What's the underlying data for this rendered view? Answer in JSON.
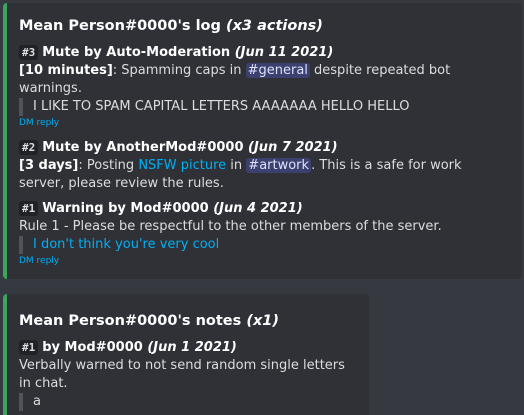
{
  "log": {
    "title": "Mean Person#0000's log",
    "count": "(x3 actions)",
    "entries": [
      {
        "num": "#3",
        "action": "Mute by Auto-Moderation",
        "date": "(Jun 11 2021)",
        "duration": "[10 minutes]",
        "text_before": ": Spamming caps in ",
        "mention": "#general",
        "text_after": " despite repeated bot warnings.",
        "quote": "I LIKE TO SPAM CAPITAL LETTERS AAAAAAA HELLO HELLO",
        "dm_reply": "DM reply"
      },
      {
        "num": "#2",
        "action": "Mute by AnotherMod#0000",
        "date": "(Jun 7 2021)",
        "duration": "[3 days]",
        "text_before": ": Posting ",
        "link": "NSFW picture",
        "text_mid": " in ",
        "mention": "#artwork",
        "text_after": ". This is a safe for work server, please review the rules."
      },
      {
        "num": "#1",
        "action": "Warning by Mod#0000",
        "date": "(Jun 4 2021)",
        "text": "Rule 1 - Please be respectful to the other members of the server.",
        "quote": "I don't think you're very cool",
        "dm_reply": "DM reply"
      }
    ]
  },
  "notes": {
    "title": "Mean Person#0000's notes",
    "count": "(x1)",
    "entries": [
      {
        "num": "#1",
        "action": "by Mod#0000",
        "date": "(Jun 1 2021)",
        "text": "Verbally warned to not send random single letters in chat.",
        "quote": "a"
      }
    ]
  },
  "colors": {
    "background": "#36393f",
    "embed": "#2f3136",
    "accent_bar": "#3ba55d",
    "link": "#00aff4"
  }
}
